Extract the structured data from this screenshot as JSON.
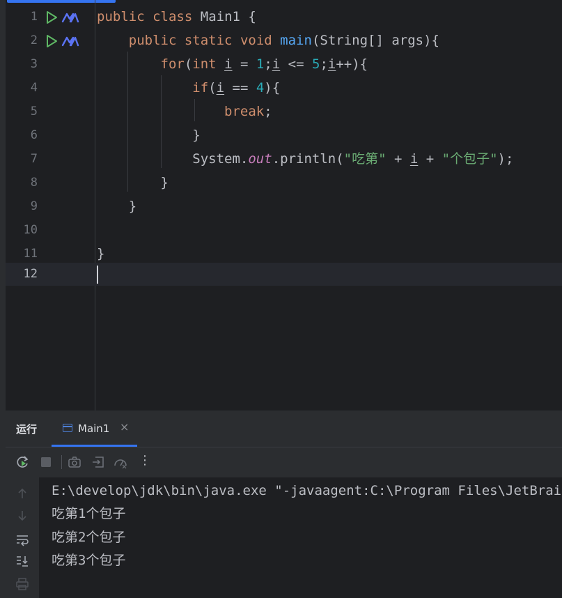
{
  "editor": {
    "lines": [
      {
        "n": "1"
      },
      {
        "n": "2"
      },
      {
        "n": "3"
      },
      {
        "n": "4"
      },
      {
        "n": "5"
      },
      {
        "n": "6"
      },
      {
        "n": "7"
      },
      {
        "n": "8"
      },
      {
        "n": "9"
      },
      {
        "n": "10"
      },
      {
        "n": "11"
      },
      {
        "n": "12"
      }
    ],
    "current_line": "12",
    "code": {
      "l1": {
        "kw1": "public",
        "kw2": "class",
        "name": "Main1",
        "brace": "{"
      },
      "l2": {
        "kw1": "public",
        "kw2": "static",
        "kw3": "void",
        "fn": "main",
        "rest": "(String[] args){"
      },
      "l3": {
        "kw": "for",
        "p1": "(",
        "t": "int",
        "v": "i",
        "eq": " = ",
        "n1": "1",
        "semi1": ";",
        "v2": "i",
        "le": " <= ",
        "n2": "5",
        "semi2": ";",
        "v3": "i",
        "inc": "++){"
      },
      "l4": {
        "kw": "if",
        "p1": "(",
        "v": "i",
        "op": " == ",
        "n": "4",
        "p2": "){"
      },
      "l5": {
        "kw": "break",
        "semi": ";"
      },
      "l6": {
        "b": "}"
      },
      "l7": {
        "cls": "System.",
        "fld": "out",
        "call": ".println(",
        "s1": "\"吃第\"",
        "plus1": " + ",
        "v": "i",
        "plus2": " + ",
        "s2": "\"个包子\"",
        "end": ");"
      },
      "l8": {
        "b": "}"
      },
      "l9": {
        "b": "}"
      },
      "l11": {
        "b": "}"
      }
    }
  },
  "run_panel": {
    "title": "运行",
    "tab_label": "Main1",
    "tab_close": "×",
    "more": "⋮"
  },
  "console": {
    "lines": [
      "E:\\develop\\jdk\\bin\\java.exe \"-javaagent:C:\\Program Files\\JetBrains",
      "吃第1个包子",
      "吃第2个包子",
      "吃第3个包子"
    ]
  },
  "colors": {
    "keyword": "#cf8e6d",
    "number": "#2aacb8",
    "string": "#6aab73",
    "function": "#56a8f5",
    "field": "#c77dbb",
    "text": "#bcbec4",
    "background": "#1e1f22",
    "panel": "#2b2d30",
    "accent": "#3574f0"
  },
  "icons": [
    "run-gutter-icon",
    "m-plugin-icon",
    "rerun-icon",
    "stop-icon",
    "camera-icon",
    "exit-icon",
    "profiler-icon",
    "more-icon",
    "up-arrow-icon",
    "down-arrow-icon",
    "soft-wrap-icon",
    "scroll-to-end-icon",
    "print-icon",
    "console-tab-icon"
  ]
}
